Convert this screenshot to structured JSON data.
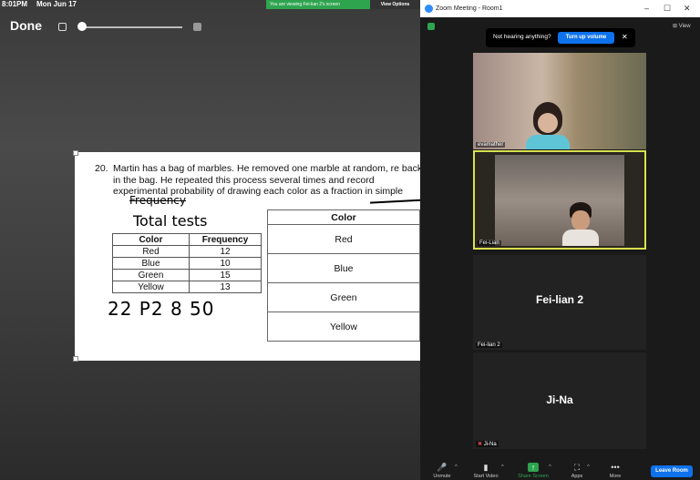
{
  "status": {
    "time": "8:01PM",
    "date": "Mon Jun 17"
  },
  "editor": {
    "done_label": "Done"
  },
  "share_bar": {
    "viewing": "You are viewing Fei-lian 2's screen",
    "options": "View Options"
  },
  "worksheet": {
    "number": "20.",
    "question": "Martin has a bag of marbles. He removed one marble at random, re back in the bag. He repeated this process several times and record experimental probability of drawing each color as a fraction in simple",
    "handwriting": {
      "scribble": "Frequency",
      "total": "Total tests",
      "numbers": "22 P2 8 50"
    },
    "freq_table": {
      "headers": [
        "Color",
        "Frequency"
      ],
      "rows": [
        [
          "Red",
          "12"
        ],
        [
          "Blue",
          "10"
        ],
        [
          "Green",
          "15"
        ],
        [
          "Yellow",
          "13"
        ]
      ]
    },
    "color_table": {
      "header": "Color",
      "rows": [
        "Red",
        "Blue",
        "Green",
        "Yellow"
      ]
    }
  },
  "zoom": {
    "title": "Zoom Meeting - Room1",
    "view_label": "View",
    "notice": {
      "message": "Not hearing anything?",
      "button": "Turn up volume"
    },
    "participants": [
      {
        "label": "evamather"
      },
      {
        "label": "Fei-Lian"
      },
      {
        "name": "Fei-lian 2",
        "label": "Fei-lian 2"
      },
      {
        "name": "Ji-Na",
        "label": "Ji-Na"
      }
    ],
    "toolbar": {
      "unmute": "Unmute",
      "start_video": "Start Video",
      "share_screen": "Share Screen",
      "apps": "Apps",
      "more": "More",
      "leave": "Leave Room"
    }
  },
  "colors": {
    "accent": "#0e72ed",
    "share_green": "#2ea44f",
    "active_speaker": "#d7e24c"
  }
}
